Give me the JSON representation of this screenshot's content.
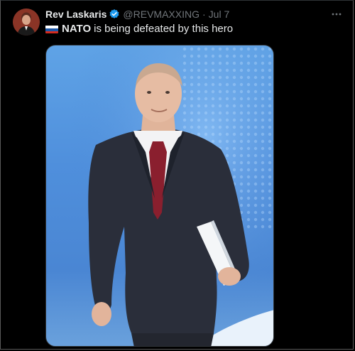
{
  "tweet": {
    "author_name": "Rev Laskaris",
    "author_handle": "@REVMAXXING",
    "separator": "·",
    "date": "Jul 7",
    "text_bold": "NATO",
    "text_rest": "is being defeated by this hero",
    "flag_icon": "russia-flag-icon",
    "verified_color": "#1d9bf0"
  }
}
